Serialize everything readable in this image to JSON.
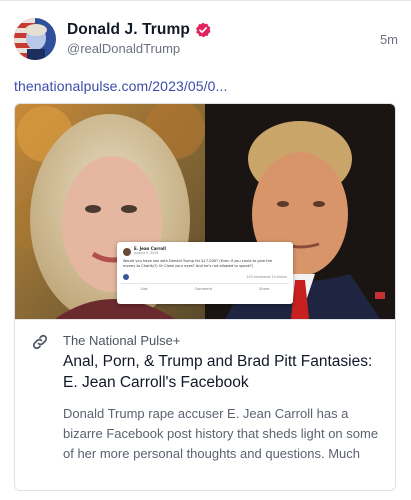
{
  "post": {
    "author_name": "Donald J. Trump",
    "handle": "@realDonaldTrump",
    "timestamp": "5m",
    "link_text": "thenationalpulse.com/2023/05/0..."
  },
  "card": {
    "source": "The National Pulse+",
    "title": "Anal, Porn, & Trump and Brad Pitt Fantasies: E. Jean Carroll's Facebook",
    "description": "Donald Trump rape accuser E. Jean Carroll has a bizarre Facebook post history that sheds light on some of her more personal thoughts and questions. Much",
    "embedded_post": {
      "name": "E. Jean Carroll",
      "date": "August 5, 2016",
      "text": "Would you have sex with Donald Trump for $17,000? (Even if you could to give the money to Charity?) Or Close your eyes? And he's not allowed to speak?)",
      "stats": "105 comments  19 shares",
      "actions": [
        "Like",
        "Comment",
        "Share"
      ]
    }
  },
  "colors": {
    "link": "#3a4da8",
    "verified_badge": "#e0245e",
    "muted_text": "#6b7280"
  },
  "icons": [
    "verified-badge-icon",
    "link-icon"
  ]
}
